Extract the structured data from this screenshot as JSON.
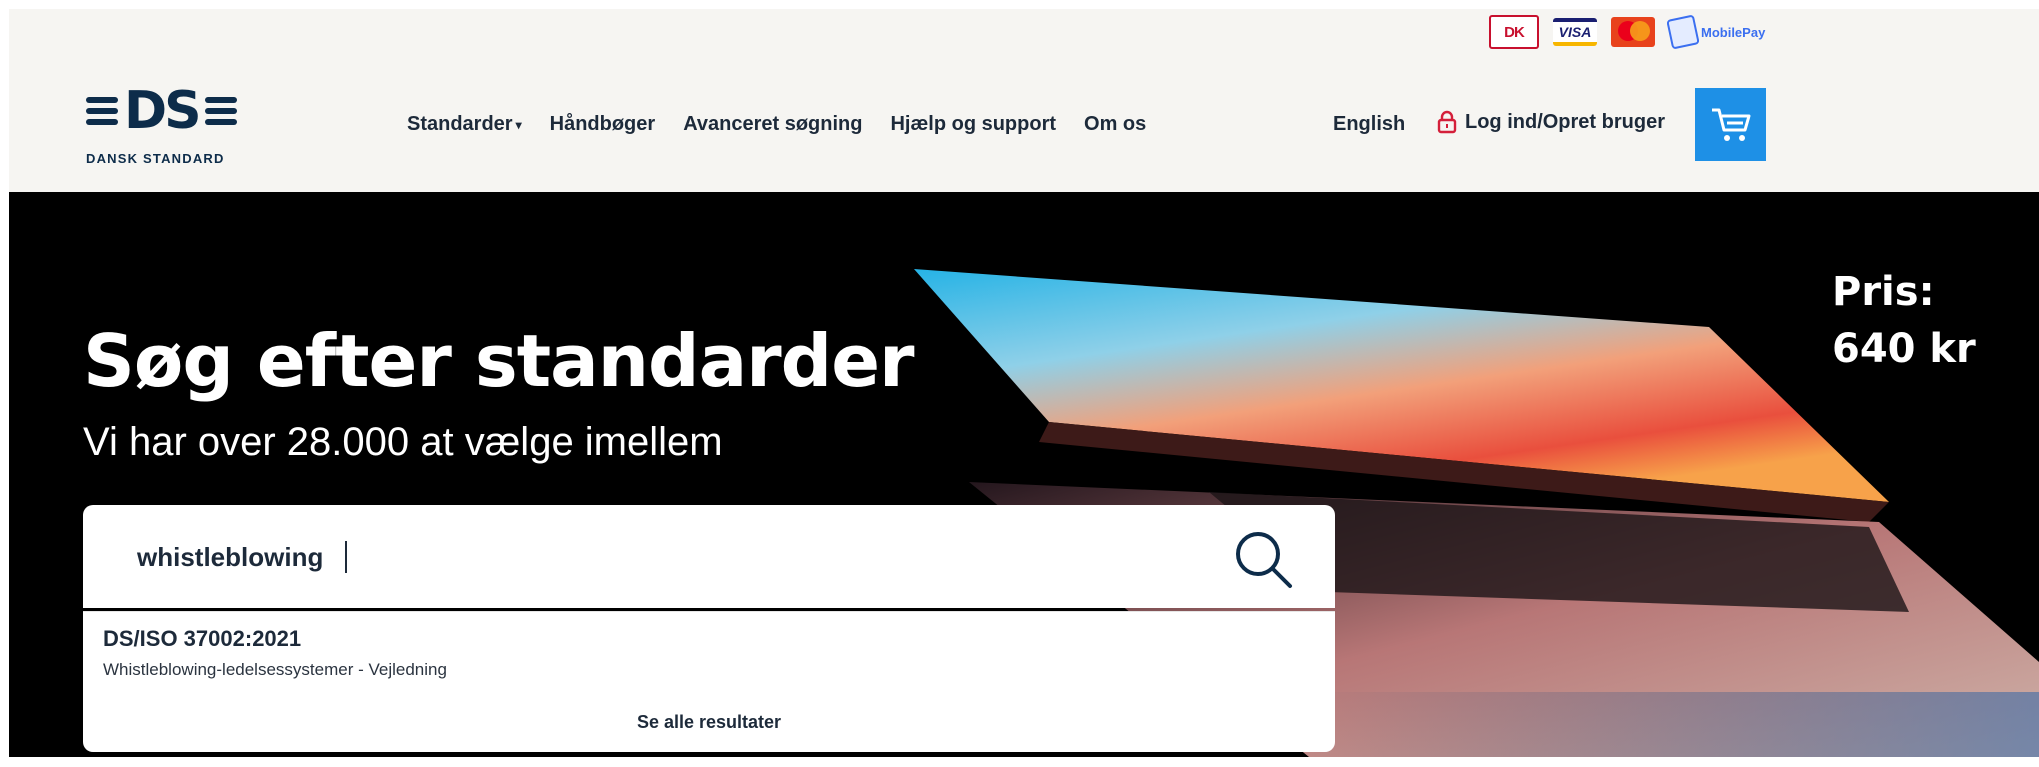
{
  "header": {
    "payments": [
      "DK",
      "VISA",
      "MasterCard",
      "MobilePay"
    ],
    "logo_text": "DANSK STANDARD",
    "logo_mark": "DS",
    "nav": [
      {
        "label": "Standarder",
        "has_dropdown": true
      },
      {
        "label": "Håndbøger"
      },
      {
        "label": "Avanceret søgning"
      },
      {
        "label": "Hjælp og support"
      },
      {
        "label": "Om os"
      }
    ],
    "language": "English",
    "login": "Log ind/Opret bruger",
    "cart_icon": "cart-icon"
  },
  "hero": {
    "title": "Søg efter standarder",
    "subtitle": "Vi har over 28.000 at vælge imellem",
    "price_label": "Pris:",
    "price_value": "640 kr"
  },
  "search": {
    "value": "whistleblowing",
    "icon": "search-icon"
  },
  "results": {
    "items": [
      {
        "code": "DS/ISO 37002:2021",
        "title": "Whistleblowing-ledelsessystemer - Vejledning"
      }
    ],
    "see_all": "Se alle resultater"
  },
  "colors": {
    "brand_navy": "#0d2c4a",
    "cart_blue": "#1e90e6",
    "login_lock": "#d41f3a",
    "header_bg": "#f6f5f2"
  }
}
